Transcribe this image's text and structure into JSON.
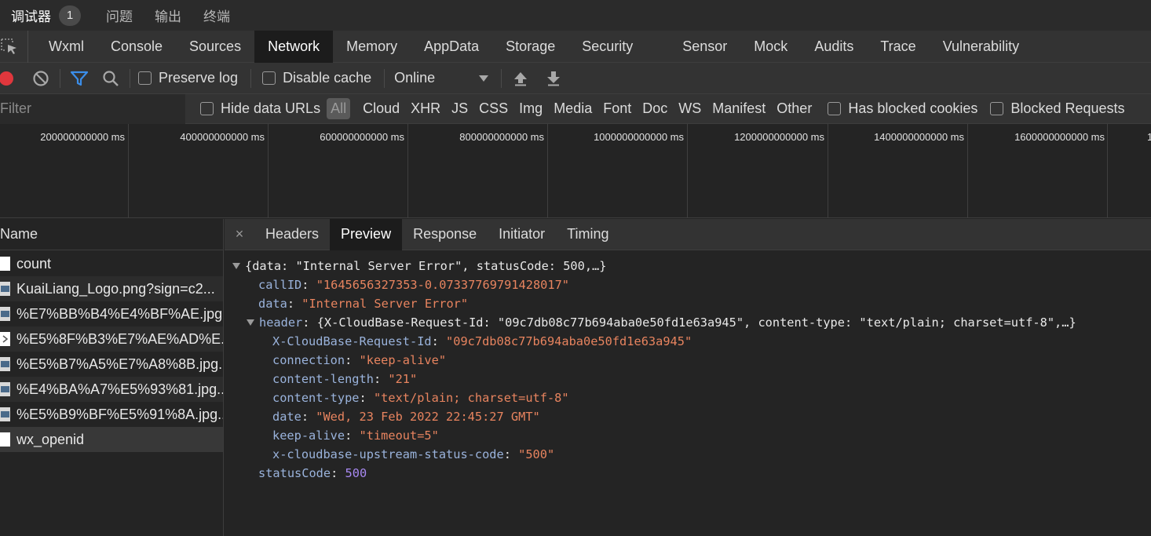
{
  "panel_tabs": {
    "debugger": "调试器",
    "debugger_badge": "1",
    "problems": "问题",
    "output": "输出",
    "terminal": "终端"
  },
  "devtools_tabs": [
    "Wxml",
    "Console",
    "Sources",
    "Network",
    "Memory",
    "AppData",
    "Storage",
    "Security",
    "Sensor",
    "Mock",
    "Audits",
    "Trace",
    "Vulnerability"
  ],
  "active_devtools_tab": "Network",
  "toolbar": {
    "preserve_log": "Preserve log",
    "disable_cache": "Disable cache",
    "throttle": "Online"
  },
  "filterbar": {
    "placeholder": "Filter",
    "hide_data_urls": "Hide data URLs",
    "types": [
      "All",
      "Cloud",
      "XHR",
      "JS",
      "CSS",
      "Img",
      "Media",
      "Font",
      "Doc",
      "WS",
      "Manifest",
      "Other"
    ],
    "has_blocked_cookies": "Has blocked cookies",
    "blocked_requests": "Blocked Requests"
  },
  "timeline": {
    "labels": [
      "200000000000 ms",
      "400000000000 ms",
      "600000000000 ms",
      "800000000000 ms",
      "1000000000000 ms",
      "1200000000000 ms",
      "1400000000000 ms",
      "1600000000000 ms",
      "1"
    ]
  },
  "request_list": {
    "header": "Name",
    "rows": [
      {
        "name": "count",
        "icon": "file-icon"
      },
      {
        "name": "KuaiLiang_Logo.png?sign=c2...",
        "icon": "image-icon"
      },
      {
        "name": "%E7%BB%B4%E4%BF%AE.jpg...",
        "icon": "image-icon"
      },
      {
        "name": "%E5%8F%B3%E7%AE%AD%E...",
        "icon": "arrow-icon"
      },
      {
        "name": "%E5%B7%A5%E7%A8%8B.jpg...",
        "icon": "image-icon"
      },
      {
        "name": "%E4%BA%A7%E5%93%81.jpg...",
        "icon": "image-icon"
      },
      {
        "name": "%E5%B9%BF%E5%91%8A.jpg...",
        "icon": "image-icon"
      },
      {
        "name": "wx_openid",
        "icon": "file-icon"
      }
    ]
  },
  "detail_tabs": {
    "close": "×",
    "tabs": [
      "Headers",
      "Preview",
      "Response",
      "Initiator",
      "Timing"
    ],
    "active": "Preview"
  },
  "preview": {
    "summary": "{data: \"Internal Server Error\", statusCode: 500,…}",
    "callID_key": "callID",
    "callID_val": "\"1645656327353-0.07337769791428017\"",
    "data_key": "data",
    "data_val": "\"Internal Server Error\"",
    "header_key": "header",
    "header_summary": "{X-CloudBase-Request-Id: \"09c7db08c77b694aba0e50fd1e63a945\", content-type: \"text/plain; charset=utf-8\",…}",
    "header_fields": [
      {
        "key": "X-CloudBase-Request-Id",
        "val": "\"09c7db08c77b694aba0e50fd1e63a945\""
      },
      {
        "key": "connection",
        "val": "\"keep-alive\""
      },
      {
        "key": "content-length",
        "val": "\"21\""
      },
      {
        "key": "content-type",
        "val": "\"text/plain; charset=utf-8\""
      },
      {
        "key": "date",
        "val": "\"Wed, 23 Feb 2022 22:45:27 GMT\""
      },
      {
        "key": "keep-alive",
        "val": "\"timeout=5\""
      },
      {
        "key": "x-cloudbase-upstream-status-code",
        "val": "\"500\""
      }
    ],
    "statusCode_key": "statusCode",
    "statusCode_val": "500"
  },
  "colors": {
    "key": "#9ab3dc",
    "string": "#e8845f",
    "number": "#a889f2",
    "record_red": "#e0373d",
    "filter_blue": "#3b8eea"
  }
}
